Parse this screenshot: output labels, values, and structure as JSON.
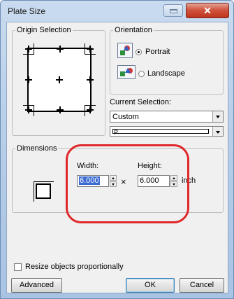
{
  "window": {
    "title": "Plate Size",
    "close_glyph": "✕",
    "minimize_icon": "minimize-icon"
  },
  "origin": {
    "legend": "Origin Selection"
  },
  "orientation": {
    "legend": "Orientation",
    "portrait_label": "Portrait",
    "landscape_label": "Landscape",
    "selected": "Portrait"
  },
  "current_selection": {
    "label": "Current Selection:",
    "value": "Custom",
    "sub_value": "P"
  },
  "dimensions": {
    "legend": "Dimensions",
    "width_label": "Width:",
    "height_label": "Height:",
    "width_value": "6.000",
    "height_value": "6.000",
    "times": "×",
    "unit": "inch"
  },
  "footer": {
    "resize_label": "Resize objects proportionally",
    "advanced_label": "Advanced",
    "ok_label": "OK",
    "cancel_label": "Cancel"
  },
  "colors": {
    "highlight_ring": "#e0272a",
    "selection": "#3b6bd1"
  }
}
